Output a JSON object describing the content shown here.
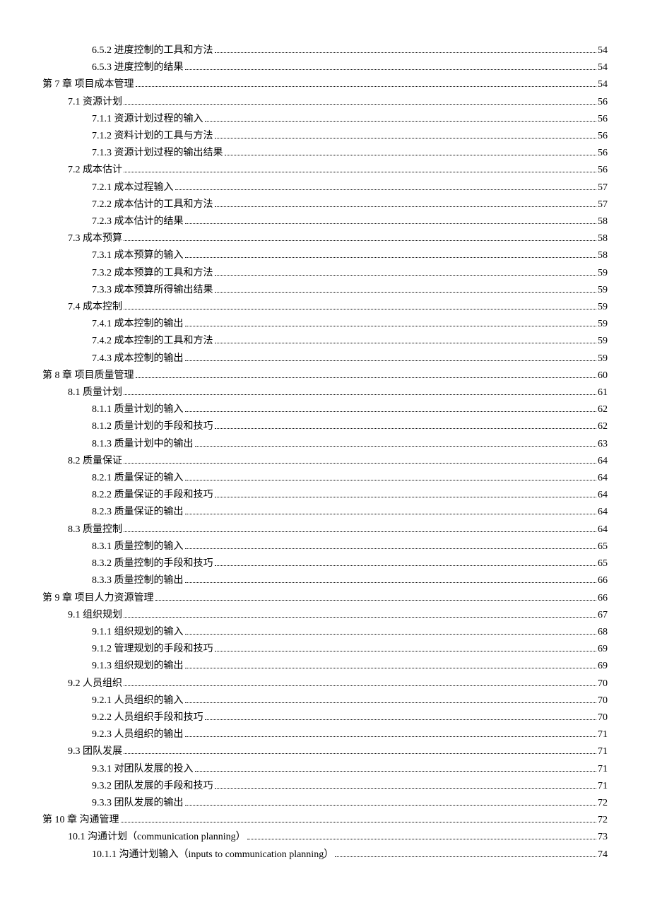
{
  "toc": [
    {
      "indent": 2,
      "label": "6.5.2 进度控制的工具和方法",
      "page": "54"
    },
    {
      "indent": 2,
      "label": "6.5.3 进度控制的结果",
      "page": "54"
    },
    {
      "indent": 0,
      "label": "第 7 章  项目成本管理",
      "page": "54"
    },
    {
      "indent": 1,
      "label": "7.1 资源计划",
      "page": "56"
    },
    {
      "indent": 2,
      "label": "7.1.1 资源计划过程的输入",
      "page": "56"
    },
    {
      "indent": 2,
      "label": "7.1.2 资料计划的工具与方法",
      "page": "56"
    },
    {
      "indent": 2,
      "label": "7.1.3 资源计划过程的输出结果",
      "page": "56"
    },
    {
      "indent": 1,
      "label": "7.2 成本估计",
      "page": "56"
    },
    {
      "indent": 2,
      "label": "7.2.1 成本过程输入",
      "page": "57"
    },
    {
      "indent": 2,
      "label": "7.2.2 成本估计的工具和方法",
      "page": "57"
    },
    {
      "indent": 2,
      "label": "7.2.3  成本估计的结果",
      "page": "58"
    },
    {
      "indent": 1,
      "label": "7.3 成本预算",
      "page": "58"
    },
    {
      "indent": 2,
      "label": "7.3.1  成本预算的输入",
      "page": "58"
    },
    {
      "indent": 2,
      "label": "7.3.2  成本预算的工具和方法",
      "page": "59"
    },
    {
      "indent": 2,
      "label": "7.3.3  成本预算所得输出结果",
      "page": "59"
    },
    {
      "indent": 1,
      "label": "7.4  成本控制",
      "page": "59"
    },
    {
      "indent": 2,
      "label": "7.4.1  成本控制的输出",
      "page": "59"
    },
    {
      "indent": 2,
      "label": "7.4.2  成本控制的工具和方法",
      "page": "59"
    },
    {
      "indent": 2,
      "label": "7.4.3  成本控制的输出",
      "page": "59"
    },
    {
      "indent": 0,
      "label": "第 8 章  项目质量管理",
      "page": "60"
    },
    {
      "indent": 1,
      "label": "8.1 质量计划",
      "page": "61"
    },
    {
      "indent": 2,
      "label": "8.1.1  质量计划的输入",
      "page": "62"
    },
    {
      "indent": 2,
      "label": "8.1.2 质量计划的手段和技巧",
      "page": "62"
    },
    {
      "indent": 2,
      "label": "8.1.3 质量计划中的输出",
      "page": "63"
    },
    {
      "indent": 1,
      "label": "8.2 质量保证",
      "page": "64"
    },
    {
      "indent": 2,
      "label": "8.2.1 质量保证的输入",
      "page": "64"
    },
    {
      "indent": 2,
      "label": "8.2.2 质量保证的手段和技巧",
      "page": "64"
    },
    {
      "indent": 2,
      "label": "8.2.3 质量保证的输出",
      "page": "64"
    },
    {
      "indent": 1,
      "label": "8.3 质量控制",
      "page": "64"
    },
    {
      "indent": 2,
      "label": "8.3.1 质量控制的输入",
      "page": "65"
    },
    {
      "indent": 2,
      "label": "8.3.2 质量控制的手段和技巧",
      "page": "65"
    },
    {
      "indent": 2,
      "label": "8.3.3 质量控制的输出",
      "page": "66"
    },
    {
      "indent": 0,
      "label": "第 9 章  项目人力资源管理",
      "page": "66"
    },
    {
      "indent": 1,
      "label": "9.1 组织规划",
      "page": "67"
    },
    {
      "indent": 2,
      "label": "9.1.1 组织规划的输入",
      "page": "68"
    },
    {
      "indent": 2,
      "label": "9.1.2 管理规划的手段和技巧",
      "page": "69"
    },
    {
      "indent": 2,
      "label": "9.1.3 组织规划的输出",
      "page": "69"
    },
    {
      "indent": 1,
      "label": "9.2 人员组织",
      "page": "70"
    },
    {
      "indent": 2,
      "label": "9.2.1 人员组织的输入",
      "page": "70"
    },
    {
      "indent": 2,
      "label": "9.2.2 人员组织手段和技巧",
      "page": "70"
    },
    {
      "indent": 2,
      "label": "9.2.3 人员组织的输出",
      "page": "71"
    },
    {
      "indent": 1,
      "label": "9.3 团队发展",
      "page": "71"
    },
    {
      "indent": 2,
      "label": "9.3.1 对团队发展的投入",
      "page": "71"
    },
    {
      "indent": 2,
      "label": "9.3.2 团队发展的手段和技巧",
      "page": "71"
    },
    {
      "indent": 2,
      "label": "9.3.3 团队发展的输出",
      "page": "72"
    },
    {
      "indent": 0,
      "label": "第 10 章  沟通管理",
      "page": "72"
    },
    {
      "indent": 1,
      "label": "10.1 沟通计划（communication planning）",
      "page": "73"
    },
    {
      "indent": 2,
      "label": "10.1.1 沟通计划输入（inputs to communication planning）",
      "page": "74"
    }
  ]
}
